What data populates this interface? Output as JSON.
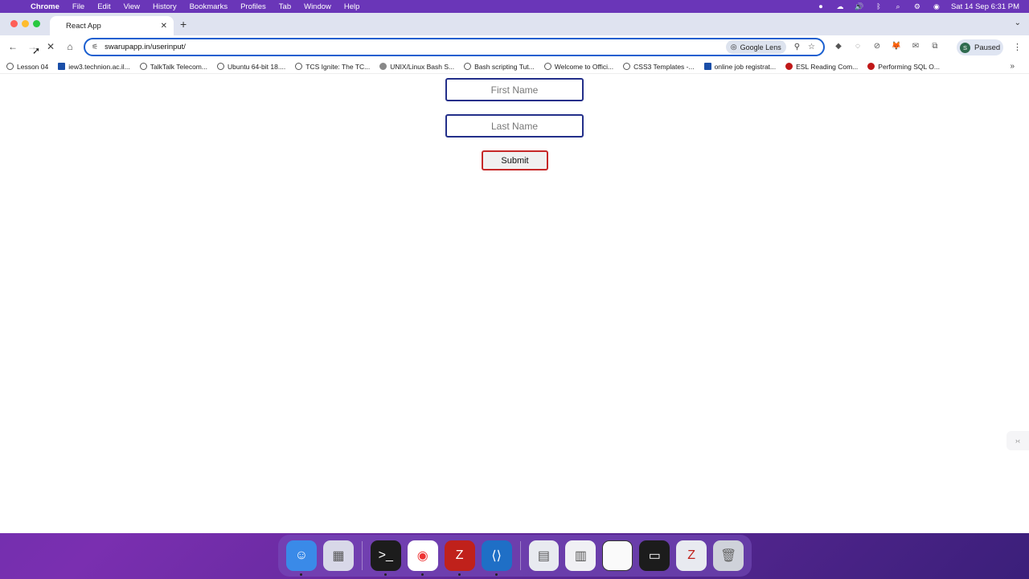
{
  "menubar": {
    "items": [
      "Chrome",
      "File",
      "Edit",
      "View",
      "History",
      "Bookmarks",
      "Profiles",
      "Tab",
      "Window",
      "Help"
    ],
    "clock": "Sat 14 Sep  6:31 PM"
  },
  "tab": {
    "title": "React App"
  },
  "toolbar": {
    "url": "swarupapp.in/userinput/",
    "lens_label": "Google Lens",
    "profile_initial": "S",
    "profile_status": "Paused"
  },
  "bookmarks": [
    {
      "label": "Lesson 04"
    },
    {
      "label": "iew3.technion.ac.il..."
    },
    {
      "label": "TalkTalk Telecom..."
    },
    {
      "label": "Ubuntu 64-bit 18...."
    },
    {
      "label": "TCS Ignite: The TC..."
    },
    {
      "label": "UNIX/Linux Bash S..."
    },
    {
      "label": "Bash scripting Tut..."
    },
    {
      "label": "Welcome to Offici..."
    },
    {
      "label": "CSS3 Templates -..."
    },
    {
      "label": "online job registrat..."
    },
    {
      "label": "ESL Reading Com..."
    },
    {
      "label": "Performing SQL O..."
    }
  ],
  "form": {
    "first_name_placeholder": "First Name",
    "last_name_placeholder": "Last Name",
    "submit_label": "Submit"
  }
}
